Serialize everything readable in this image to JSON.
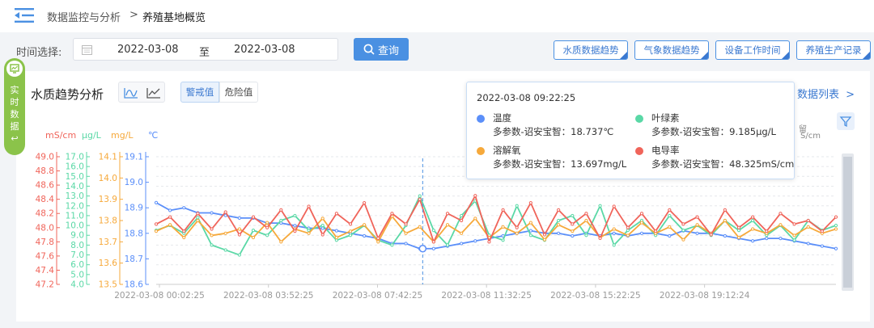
{
  "breadcrumb": {
    "parent": "数据监控与分析",
    "sep": ">",
    "current": "养殖基地概览"
  },
  "filter": {
    "label": "时间选择:",
    "start": "2022-03-08",
    "sep": "至",
    "end": "2022-03-08",
    "query": "查询"
  },
  "tabs": [
    "水质数据趋势",
    "气象数据趋势",
    "设备工作时间",
    "养殖生产记录"
  ],
  "side_tab": {
    "text": [
      "实",
      "时",
      "数",
      "据"
    ],
    "arrow": "↩"
  },
  "panel": {
    "title": "水质趋势分析",
    "seg_active": "警戒值",
    "seg_other": "危险值",
    "data_list": "数据列表",
    "legend_partial_1": "留",
    "legend_partial_2": "S/cm"
  },
  "tooltip": {
    "time": "2022-03-08 09:22:25",
    "items": [
      {
        "name": "温度",
        "value": "多参数-诏安宝智：18.737℃",
        "color": "#5b8ff9"
      },
      {
        "name": "叶绿素",
        "value": "多参数-诏安宝智：9.185μg/L",
        "color": "#5ad8a6"
      },
      {
        "name": "溶解氧",
        "value": "多参数-诏安宝智：13.697mg/L",
        "color": "#f6a93b"
      },
      {
        "name": "电导率",
        "value": "多参数-诏安宝智：48.325mS/cm",
        "color": "#f0645a"
      }
    ]
  },
  "colors": {
    "accent": "#4a90e2",
    "temp": "#5b8ff9",
    "chl": "#5ad8a6",
    "do": "#f6a93b",
    "cond": "#f0645a"
  },
  "chart_data": {
    "type": "line",
    "title": "水质趋势分析",
    "x_tick_labels": [
      "2022-03-08 00:02:25",
      "2022-03-08 03:52:25",
      "2022-03-08 07:42:25",
      "2022-03-08 11:32:25",
      "2022-03-08 15:22:25",
      "2022-03-08 19:12:24"
    ],
    "x_range_hours": [
      0,
      23.9
    ],
    "cursor_hour": 9.37,
    "grid": true,
    "axes": [
      {
        "unit": "mS/cm",
        "color": "#f0645a",
        "min": 47.2,
        "max": 49.0,
        "ticks": [
          "49.0",
          "48.8",
          "48.6",
          "48.4",
          "48.2",
          "48.0",
          "47.8",
          "47.6",
          "47.4",
          "47.2"
        ]
      },
      {
        "unit": "μg/L",
        "color": "#5ad8a6",
        "min": 4.0,
        "max": 17.0,
        "ticks": [
          "17.0",
          "16.0",
          "15.0",
          "14.0",
          "13.0",
          "12.0",
          "11.0",
          "10.0",
          "9.0",
          "8.0",
          "7.0",
          "6.0",
          "5.0",
          "4.0"
        ]
      },
      {
        "unit": "mg/L",
        "color": "#f6a93b",
        "min": 13.5,
        "max": 14.1,
        "ticks": [
          "14.1",
          "14.0",
          "13.9",
          "13.8",
          "13.7",
          "13.6",
          "13.5"
        ]
      },
      {
        "unit": "℃",
        "color": "#5b8ff9",
        "min": 18.6,
        "max": 19.1,
        "ticks": [
          "19.1",
          "19.0",
          "18.9",
          "18.8",
          "18.7",
          "18.6"
        ]
      }
    ],
    "series": [
      {
        "name": "温度",
        "axis": 3,
        "color": "#5b8ff9",
        "values": [
          18.92,
          18.89,
          18.9,
          18.88,
          18.88,
          18.87,
          18.86,
          18.86,
          18.84,
          18.84,
          18.83,
          18.82,
          18.82,
          18.81,
          18.8,
          18.79,
          18.78,
          18.76,
          18.76,
          18.74,
          18.74,
          18.75,
          18.76,
          18.77,
          18.78,
          18.79,
          18.8,
          18.81,
          18.8,
          18.8,
          18.79,
          18.8,
          18.79,
          18.8,
          18.79,
          18.8,
          18.8,
          18.79,
          18.81,
          18.8,
          18.8,
          18.79,
          18.78,
          18.77,
          18.78,
          18.78,
          18.77,
          18.76,
          18.75,
          18.74
        ]
      },
      {
        "name": "叶绿素",
        "axis": 1,
        "color": "#5ad8a6",
        "values": [
          9.5,
          10.0,
          9.2,
          10.8,
          8.0,
          7.5,
          7.0,
          9.5,
          9.0,
          10.5,
          11.0,
          9.5,
          10.0,
          8.5,
          9.0,
          10.0,
          8.5,
          8.0,
          10.0,
          13.0,
          9.5,
          8.0,
          11.0,
          12.5,
          9.0,
          8.5,
          12.0,
          9.0,
          8.5,
          10.5,
          11.0,
          9.0,
          12.0,
          8.0,
          9.5,
          10.5,
          9.0,
          11.0,
          9.5,
          10.0,
          9.0,
          10.5,
          9.5,
          10.5,
          9.0,
          10.0,
          8.5,
          10.5,
          9.5,
          10.0
        ]
      },
      {
        "name": "溶解氧",
        "axis": 2,
        "color": "#f6a93b",
        "values": [
          13.75,
          13.78,
          13.72,
          13.8,
          13.73,
          13.74,
          13.76,
          13.72,
          13.79,
          13.7,
          13.76,
          13.74,
          13.81,
          13.72,
          13.75,
          13.78,
          13.7,
          13.82,
          13.74,
          13.77,
          13.7,
          13.78,
          13.74,
          13.81,
          13.72,
          13.77,
          13.74,
          13.79,
          13.71,
          13.78,
          13.75,
          13.8,
          13.72,
          13.76,
          13.73,
          13.79,
          13.74,
          13.77,
          13.71,
          13.78,
          13.74,
          13.8,
          13.72,
          13.76,
          13.74,
          13.78,
          13.73,
          13.77,
          13.74,
          13.76
        ]
      },
      {
        "name": "电导率",
        "axis": 0,
        "color": "#f0645a",
        "values": [
          48.05,
          48.15,
          47.95,
          48.2,
          47.98,
          48.22,
          47.9,
          48.15,
          48.0,
          48.25,
          47.95,
          48.3,
          47.9,
          48.2,
          48.05,
          48.35,
          47.85,
          48.2,
          48.05,
          48.4,
          47.8,
          48.2,
          48.1,
          48.45,
          47.8,
          48.25,
          48.0,
          48.35,
          47.9,
          48.25,
          48.05,
          48.2,
          47.85,
          48.3,
          48.0,
          48.2,
          47.95,
          48.25,
          48.05,
          48.15,
          47.9,
          48.25,
          48.0,
          48.15,
          47.95,
          48.2,
          48.05,
          48.1,
          47.95,
          48.15
        ]
      }
    ]
  }
}
